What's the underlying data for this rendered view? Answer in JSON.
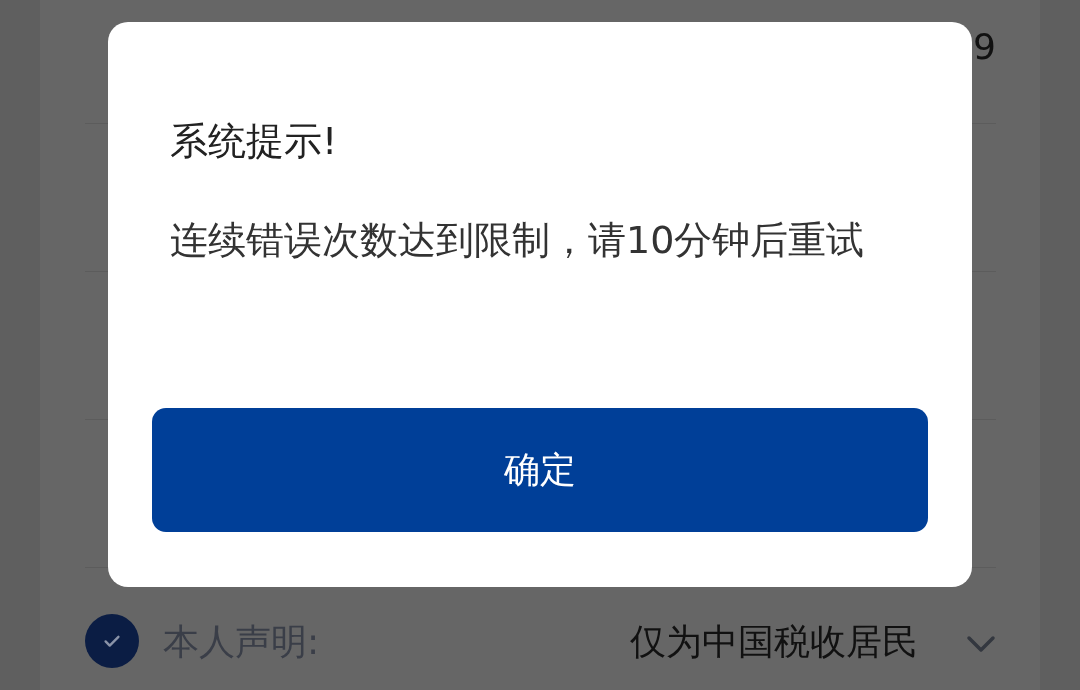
{
  "form_rows": [
    {
      "value": "9"
    }
  ],
  "declaration": {
    "checked": true,
    "label": "本人声明:",
    "value": "仅为中国税收居民"
  },
  "dialog": {
    "title": "系统提示!",
    "message": "连续错误次数达到限制，请10分钟后重试",
    "confirm_button": "确定"
  }
}
